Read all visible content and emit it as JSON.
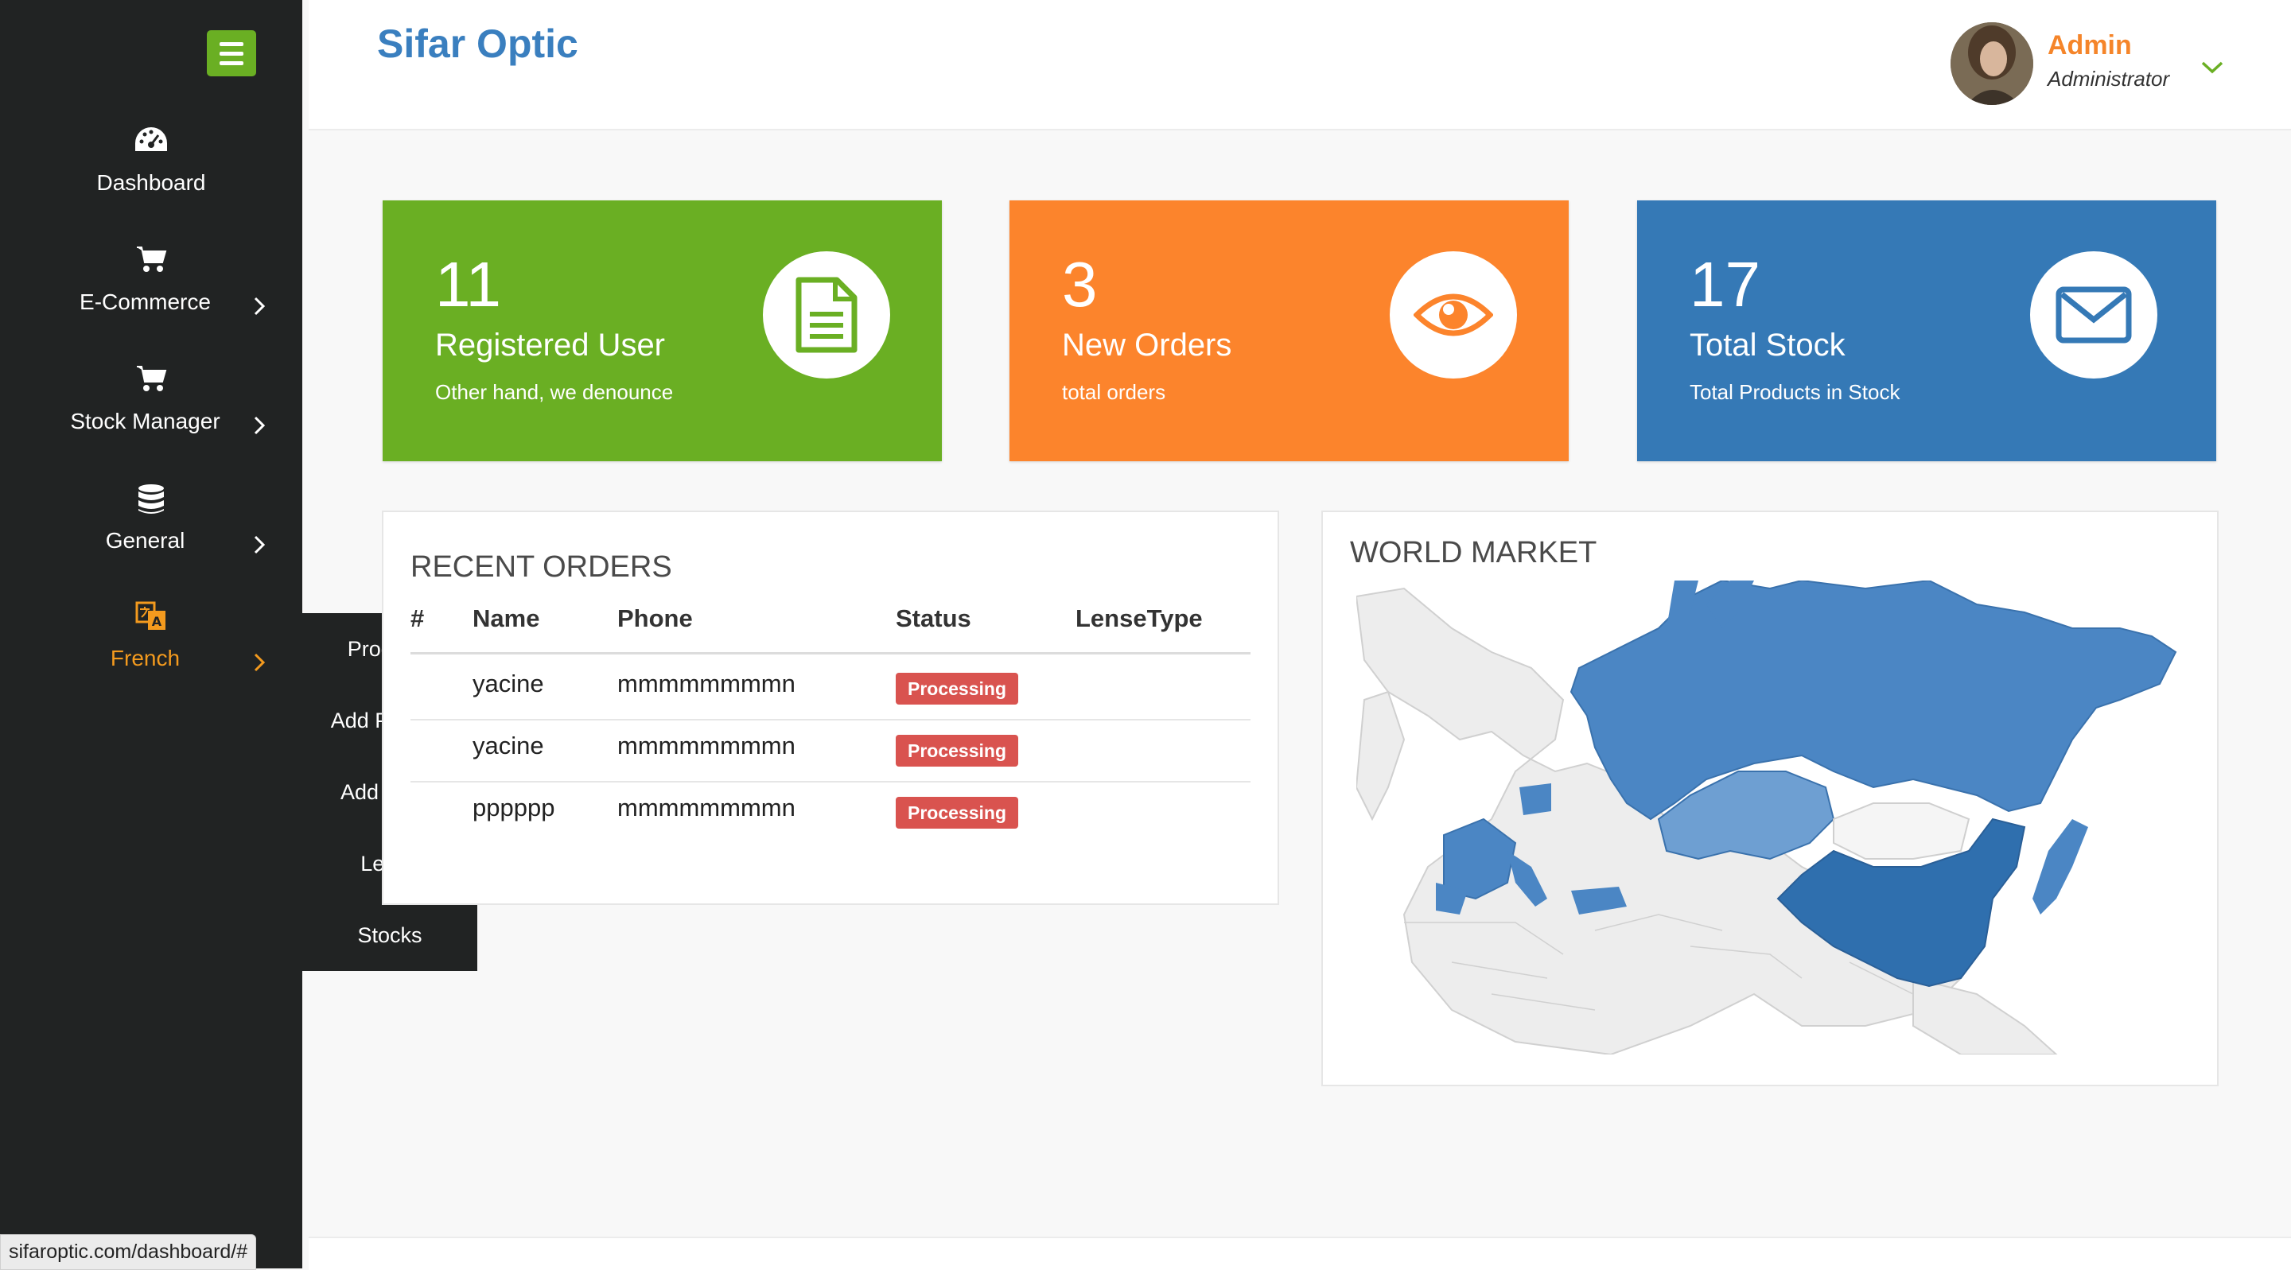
{
  "app": {
    "brand": "Sifar Optic"
  },
  "user": {
    "name": "Admin",
    "role": "Administrator"
  },
  "sidebar": {
    "items": [
      {
        "label": "Dashboard",
        "icon": "tachometer-icon",
        "has_submenu": false
      },
      {
        "label": "E-Commerce",
        "icon": "cart-icon",
        "has_submenu": true
      },
      {
        "label": "Stock Manager",
        "icon": "cart-icon",
        "has_submenu": true
      },
      {
        "label": "General",
        "icon": "database-icon",
        "has_submenu": true
      },
      {
        "label": "French",
        "icon": "translate-icon",
        "has_submenu": true,
        "active": true
      }
    ],
    "submenu": [
      "Products",
      "Add Product",
      "Add Video",
      "Lense",
      "Stocks"
    ]
  },
  "stats": [
    {
      "value": "11",
      "title": "Registered User",
      "subtitle": "Other hand, we denounce",
      "color": "#6aaf23",
      "icon": "document-icon"
    },
    {
      "value": "3",
      "title": "New Orders",
      "subtitle": "total orders",
      "color": "#fc842c",
      "icon": "eye-icon"
    },
    {
      "value": "17",
      "title": "Total Stock",
      "subtitle": "Total Products in Stock",
      "color": "#3579b6",
      "icon": "envelope-icon"
    }
  ],
  "recent_orders": {
    "title": "RECENT ORDERS",
    "columns": [
      "#",
      "Name",
      "Phone",
      "Status",
      "LenseType"
    ],
    "rows": [
      {
        "name": "yacine",
        "phone": "mmmmmmmmn",
        "status": "Processing",
        "lense_type": ""
      },
      {
        "name": "yacine",
        "phone": "mmmmmmmmn",
        "status": "Processing",
        "lense_type": ""
      },
      {
        "name": "pppppp",
        "phone": "mmmmmmmmn",
        "status": "Processing",
        "lense_type": ""
      }
    ]
  },
  "world_market": {
    "title": "WORLD MARKET"
  },
  "status_bar": {
    "url": "sifaroptic.com/dashboard/#"
  },
  "colors": {
    "sidebar_bg": "#212323",
    "accent_green": "#6aaf23",
    "accent_orange": "#f39a1e",
    "badge_red": "#d9534f",
    "map_blue": "#3a7fbf"
  }
}
